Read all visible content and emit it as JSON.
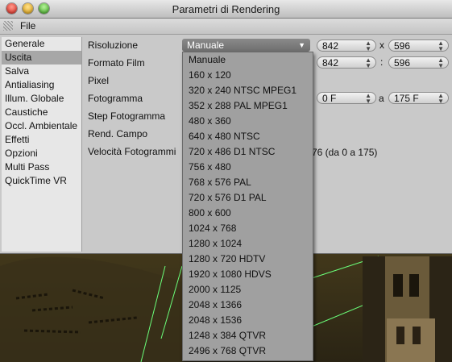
{
  "window": {
    "title": "Parametri di Rendering"
  },
  "menubar": {
    "file": "File"
  },
  "sidebar": {
    "items": [
      {
        "label": "Generale"
      },
      {
        "label": "Uscita"
      },
      {
        "label": "Salva"
      },
      {
        "label": "Antialiasing"
      },
      {
        "label": "Illum. Globale"
      },
      {
        "label": "Caustiche"
      },
      {
        "label": "Occl. Ambientale"
      },
      {
        "label": "Effetti"
      },
      {
        "label": "Opzioni"
      },
      {
        "label": "Multi Pass"
      },
      {
        "label": "QuickTime VR"
      }
    ],
    "selected_index": 1
  },
  "form": {
    "labels": {
      "risoluzione": "Risoluzione",
      "formato_film": "Formato Film",
      "pixel": "Pixel",
      "fotogramma": "Fotogramma",
      "step_fotogramma": "Step Fotogramma",
      "rend_campo": "Rend. Campo",
      "velocita": "Velocità Fotogrammi"
    },
    "risoluzione_value": "Manuale",
    "res_width": "842",
    "res_height": "596",
    "film_width": "842",
    "film_height": "596",
    "x_sep": "x",
    "colon_sep": ":",
    "frame_from": "0 F",
    "frame_a": "a",
    "frame_to": "175 F",
    "partial_text": "76 (da 0 a 175)"
  },
  "dropdown": {
    "options": [
      "Manuale",
      "160 x 120",
      "320 x 240 NTSC MPEG1",
      "352 x 288 PAL MPEG1",
      "480 x 360",
      "640 x 480 NTSC",
      "720 x 486 D1 NTSC",
      "756 x 480",
      "768 x 576 PAL",
      "720 x 576 D1 PAL",
      "800 x 600",
      "1024 x 768",
      "1280 x 1024",
      "1280 x 720 HDTV",
      "1920 x 1080 HDVS",
      "2000 x 1125",
      "2048 x 1366",
      "2048 x 1536",
      "1248 x 384 QTVR",
      "2496 x 768 QTVR"
    ]
  },
  "colors": {
    "window_bg": "#c9c9c9",
    "sidebar_bg": "#e7e7e7",
    "sidebar_selected": "#a7a7a7",
    "dropdown_bg": "#a0a0a0",
    "scene_bg": "#4a3f1e"
  }
}
